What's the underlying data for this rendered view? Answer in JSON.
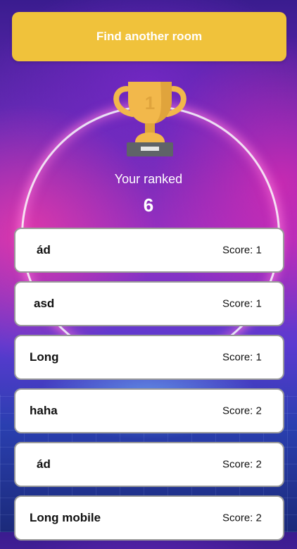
{
  "actions": {
    "find_room_label": "Find another room"
  },
  "rank": {
    "label": "Your ranked",
    "value": "6"
  },
  "trophy": {
    "icon": "trophy-icon",
    "number": "1",
    "color": "#f2b84b"
  },
  "players": [
    {
      "name": "ád",
      "score": "Score: 1"
    },
    {
      "name": "asd",
      "score": "Score: 1"
    },
    {
      "name": "Long",
      "score": "Score: 1"
    },
    {
      "name": "haha",
      "score": "Score: 2"
    },
    {
      "name": "ád",
      "score": "Score: 2"
    },
    {
      "name": "Long mobile",
      "score": "Score: 2"
    }
  ],
  "colors": {
    "button": "#f0c23b",
    "card": "#ffffff",
    "card_border": "#9a9a9a"
  }
}
